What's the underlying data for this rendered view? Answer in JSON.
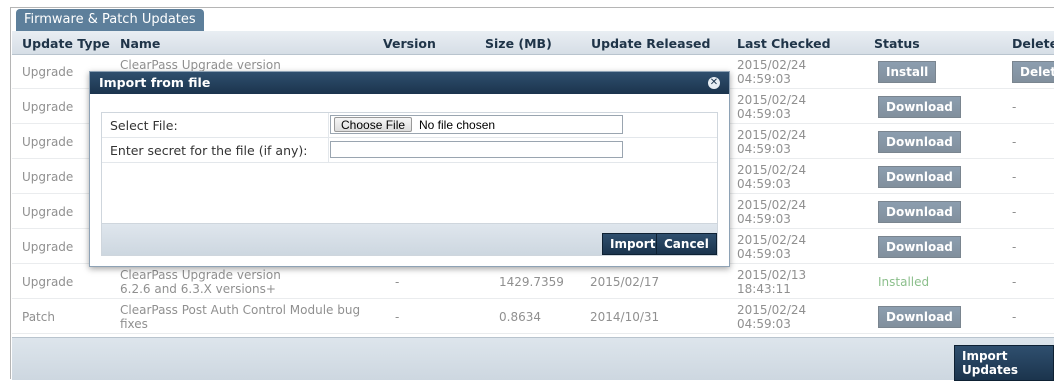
{
  "panel": {
    "title": "Firmware & Patch Updates"
  },
  "columns": {
    "type": "Update Type",
    "name": "Name",
    "version": "Version",
    "size": "Size (MB)",
    "released": "Update Released",
    "checked": "Last Checked",
    "status": "Status",
    "delete": "Delete"
  },
  "rows": [
    {
      "type": "Upgrade",
      "name1": "ClearPass Upgrade version",
      "name2": "",
      "version": "",
      "size": "",
      "released": "",
      "checked_date": "2015/02/24",
      "checked_time": "04:59:03",
      "status": "Install",
      "status_kind": "button",
      "delete": "Delete",
      "delete_kind": "button"
    },
    {
      "type": "Upgrade",
      "name1": "",
      "name2": "",
      "version": "",
      "size": "",
      "released": "",
      "checked_date": "2015/02/24",
      "checked_time": "04:59:03",
      "status": "Download",
      "status_kind": "button",
      "delete": "-",
      "delete_kind": "text"
    },
    {
      "type": "Upgrade",
      "name1": "",
      "name2": "",
      "version": "",
      "size": "",
      "released": "",
      "checked_date": "2015/02/24",
      "checked_time": "04:59:03",
      "status": "Download",
      "status_kind": "button",
      "delete": "-",
      "delete_kind": "text"
    },
    {
      "type": "Upgrade",
      "name1": "",
      "name2": "",
      "version": "",
      "size": "",
      "released": "",
      "checked_date": "2015/02/24",
      "checked_time": "04:59:03",
      "status": "Download",
      "status_kind": "button",
      "delete": "-",
      "delete_kind": "text"
    },
    {
      "type": "Upgrade",
      "name1": "",
      "name2": "",
      "version": "",
      "size": "",
      "released": "",
      "checked_date": "2015/02/24",
      "checked_time": "04:59:03",
      "status": "Download",
      "status_kind": "button",
      "delete": "-",
      "delete_kind": "text"
    },
    {
      "type": "Upgrade",
      "name1": "",
      "name2": "",
      "version": "",
      "size": "",
      "released": "",
      "checked_date": "2015/02/24",
      "checked_time": "04:59:03",
      "status": "Download",
      "status_kind": "button",
      "delete": "-",
      "delete_kind": "text"
    },
    {
      "type": "Upgrade",
      "name1": "ClearPass Upgrade version",
      "name2": "6.2.6 and 6.3.X versions+",
      "version": "-",
      "size": "1429.7359",
      "released": "2015/02/17",
      "checked_date": "2015/02/13",
      "checked_time": "18:43:11",
      "status": "Installed",
      "status_kind": "text",
      "delete": "-",
      "delete_kind": "text"
    },
    {
      "type": "Patch",
      "name1": "ClearPass Post Auth Control Module bug",
      "name2": "fixes",
      "version": "-",
      "size": "0.8634",
      "released": "2014/10/31",
      "checked_date": "2015/02/24",
      "checked_time": "04:59:03",
      "status": "Download",
      "status_kind": "button",
      "delete": "-",
      "delete_kind": "text"
    }
  ],
  "footer": {
    "import_updates": "Import Updates"
  },
  "modal": {
    "title": "Import from file",
    "close_icon": "close-icon",
    "select_file_label": "Select File:",
    "choose_file": "Choose File",
    "no_file": "No file chosen",
    "secret_label": "Enter secret for the file (if any):",
    "secret_value": "",
    "import": "Import",
    "cancel": "Cancel"
  }
}
